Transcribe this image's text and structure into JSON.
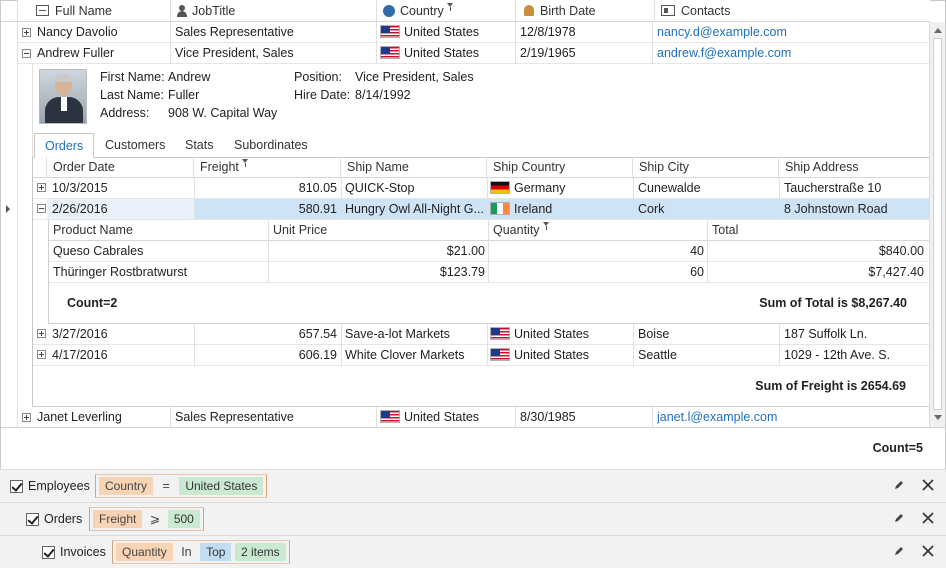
{
  "columns": {
    "full_name": "Full Name",
    "job_title": "JobTitle",
    "country": "Country",
    "birth_date": "Birth Date",
    "contacts": "Contacts"
  },
  "employees": [
    {
      "name": "Nancy Davolio",
      "title": "Sales Representative",
      "country": "United States",
      "birth": "12/8/1978",
      "email": "nancy.d@example.com"
    },
    {
      "name": "Andrew Fuller",
      "title": "Vice President, Sales",
      "country": "United States",
      "birth": "2/19/1965",
      "email": "andrew.f@example.com"
    },
    {
      "name": "Janet Leverling",
      "title": "Sales Representative",
      "country": "United States",
      "birth": "8/30/1985",
      "email": "janet.l@example.com"
    }
  ],
  "detail": {
    "first_name_label": "First Name:",
    "first_name": "Andrew",
    "last_name_label": "Last Name:",
    "last_name": "Fuller",
    "address_label": "Address:",
    "address": "908 W. Capital Way",
    "position_label": "Position:",
    "position": "Vice President, Sales",
    "hire_label": "Hire Date:",
    "hire": "8/14/1992"
  },
  "tabs": [
    "Orders",
    "Customers",
    "Stats",
    "Subordinates"
  ],
  "order_columns": {
    "date": "Order Date",
    "freight": "Freight",
    "ship_name": "Ship Name",
    "ship_country": "Ship Country",
    "ship_city": "Ship City",
    "ship_address": "Ship Address"
  },
  "orders": [
    {
      "date": "10/3/2015",
      "freight": "810.05",
      "ship_name": "QUICK-Stop",
      "country": "Germany",
      "city": "Cunewalde",
      "address": "Taucherstraße 10"
    },
    {
      "date": "2/26/2016",
      "freight": "580.91",
      "ship_name": "Hungry Owl All-Night G...",
      "country": "Ireland",
      "city": "Cork",
      "address": "8 Johnstown Road"
    },
    {
      "date": "3/27/2016",
      "freight": "657.54",
      "ship_name": "Save-a-lot Markets",
      "country": "United States",
      "city": "Boise",
      "address": "187 Suffolk Ln."
    },
    {
      "date": "4/17/2016",
      "freight": "606.19",
      "ship_name": "White Clover Markets",
      "country": "United States",
      "city": "Seattle",
      "address": "1029 - 12th Ave. S."
    }
  ],
  "invoice_columns": {
    "product": "Product Name",
    "unit_price": "Unit Price",
    "quantity": "Quantity",
    "total": "Total"
  },
  "invoices": [
    {
      "product": "Queso Cabrales",
      "unit_price": "$21.00",
      "quantity": "40",
      "total": "$840.00"
    },
    {
      "product": "Thüringer Rostbratwurst",
      "unit_price": "$123.79",
      "quantity": "60",
      "total": "$7,427.40"
    }
  ],
  "invoice_summary": {
    "count": "Count=2",
    "sum_total": "Sum of Total is $8,267.40"
  },
  "orders_summary": {
    "sum_freight": "Sum of Freight is 2654.69"
  },
  "employees_summary": {
    "count": "Count=5"
  },
  "filters": [
    {
      "label": "Employees",
      "field": "Country",
      "op": "=",
      "values": [
        "United States"
      ]
    },
    {
      "label": "Orders",
      "field": "Freight",
      "op": "⩾",
      "values": [
        "500"
      ]
    },
    {
      "label": "Invoices",
      "field": "Quantity",
      "op": "In",
      "values": [
        "Top",
        "2 items"
      ]
    }
  ]
}
